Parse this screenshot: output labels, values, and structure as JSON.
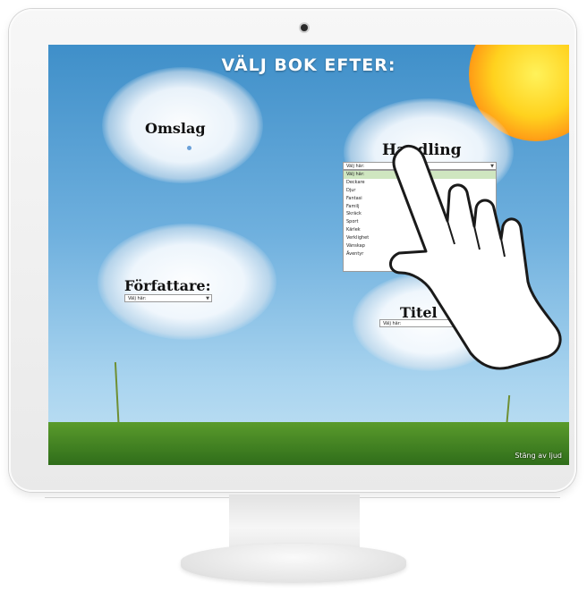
{
  "screen": {
    "title": "VÄLJ BOK EFTER:",
    "mute_label": "Stäng av ljud"
  },
  "categories": {
    "cover": {
      "label": "Omslag"
    },
    "plot": {
      "label": "Handling",
      "select_value": "Välj här:",
      "options": [
        "Välj här:",
        "Deckare",
        "Djur",
        "Fantasi",
        "Familj",
        "Skräck",
        "Sport",
        "Kärlek",
        "Verklighet",
        "Vänskap",
        "Äventyr"
      ],
      "selected_index": 0
    },
    "author": {
      "label": "Författare:",
      "select_value": "Välj här:"
    },
    "title": {
      "label": "Titel",
      "select_value": "Välj här:"
    }
  },
  "colors": {
    "sky_top": "#3f8fc9",
    "sky_bottom": "#c3e2f4",
    "sun": "#ffd21e",
    "grass": "#3f7f22",
    "option_highlight": "#cfe6c0"
  },
  "icons": [
    "camera-icon",
    "hand-pointer-icon",
    "chevron-down-icon"
  ]
}
